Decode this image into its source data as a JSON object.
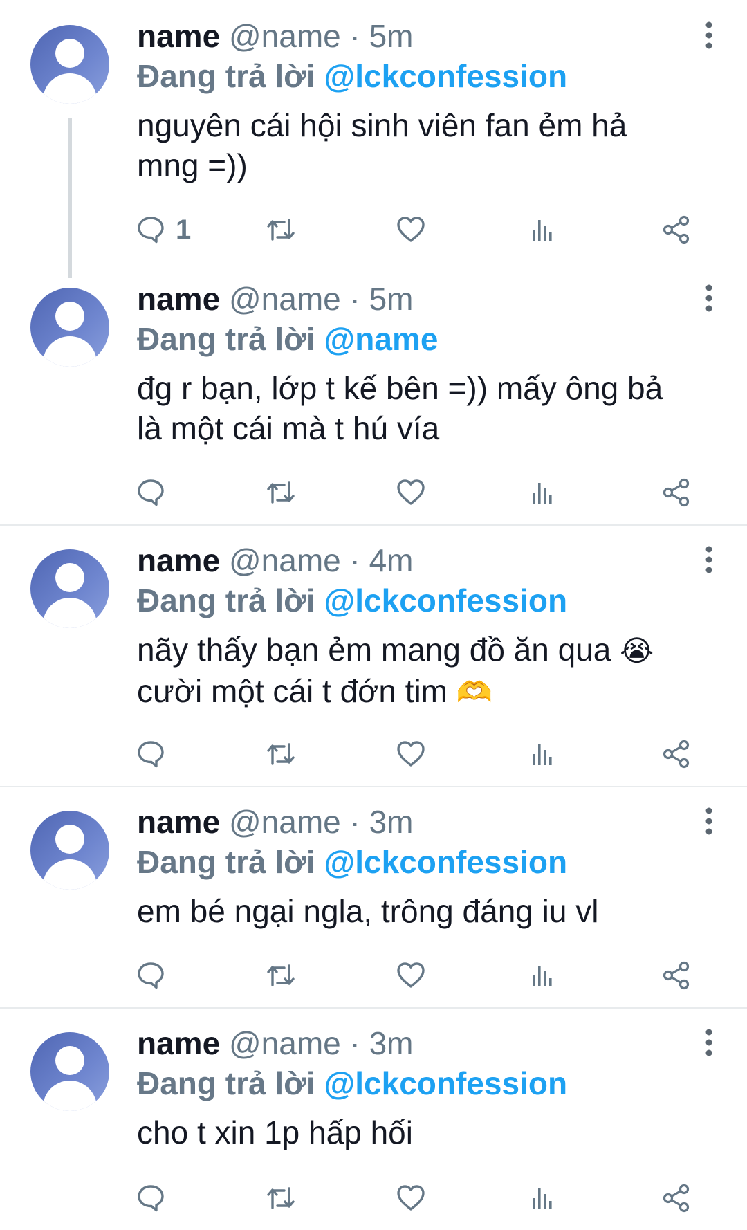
{
  "tweets": [
    {
      "name": "name",
      "meta": "@name · 5m",
      "reply_label": "Đang trả lời",
      "reply_handle": "@lckconfession",
      "text_line1": "nguyên cái hội sinh viên fan ẻm hả",
      "text_line2": "mng =))",
      "reply_count": "1"
    },
    {
      "name": "name",
      "meta": "@name · 5m",
      "reply_label": "Đang trả lời",
      "reply_handle": "@name",
      "text_line1": "đg r bạn, lớp t kế bên =)) mấy ông bả",
      "text_line2": "là một cái mà t hú vía"
    },
    {
      "name": "name",
      "meta": "@name · 4m",
      "reply_label": "Đang trả lời",
      "reply_handle": "@lckconfession",
      "text_line1": "nãy thấy bạn ẻm mang đồ ăn qua",
      "emoji1": "😭",
      "text_line2": "cười một cái t đớn tim",
      "emoji2": "🫶"
    },
    {
      "name": "name",
      "meta": "@name · 3m",
      "reply_label": "Đang trả lời",
      "reply_handle": "@lckconfession",
      "text_line1": "em bé ngại ngla, trông đáng iu vl"
    },
    {
      "name": "name",
      "meta": "@name · 3m",
      "reply_label": "Đang trả lời",
      "reply_handle": "@lckconfession",
      "text_line1": "cho t xin 1p hấp hối"
    }
  ],
  "icons": {
    "reply": "comment-icon",
    "retweet": "retweet-icon",
    "like": "heart-icon",
    "views": "bar-chart-icon",
    "share": "share-icon",
    "more": "more-vertical-icon"
  },
  "colors": {
    "handle": "#1da1f2",
    "meta": "#657786",
    "avatar": "#5f77c2"
  }
}
